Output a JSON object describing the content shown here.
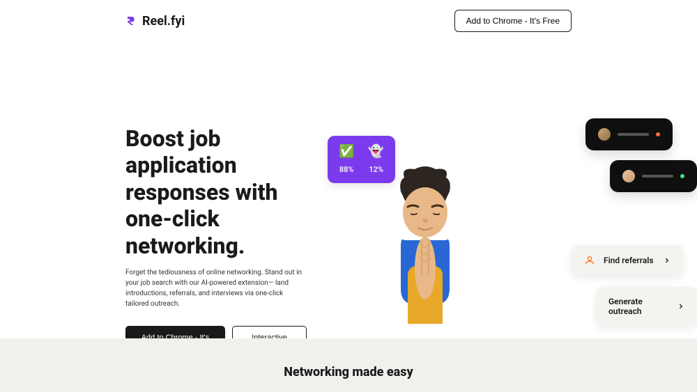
{
  "header": {
    "brand": "Reel.fyi",
    "cta": "Add to Chrome - It's Free"
  },
  "hero": {
    "title": "Boost job application responses with one-click networking.",
    "subtitle": "Forget the tediousness of online networking. Stand out in your job search with our AI-powered extension— land introductions, referrals, and interviews via one-click tailored outreach.",
    "primary_btn": "Add to Chrome - It's Free!",
    "secondary_btn": "Interactive Demo"
  },
  "stats": {
    "stat1": {
      "emoji": "✅",
      "value": "88%"
    },
    "stat2": {
      "emoji": "👻",
      "value": "12%"
    }
  },
  "actions": {
    "find_referrals": "Find referrals",
    "generate_outreach": "Generate outreach"
  },
  "footer": {
    "title": "Networking made easy"
  }
}
